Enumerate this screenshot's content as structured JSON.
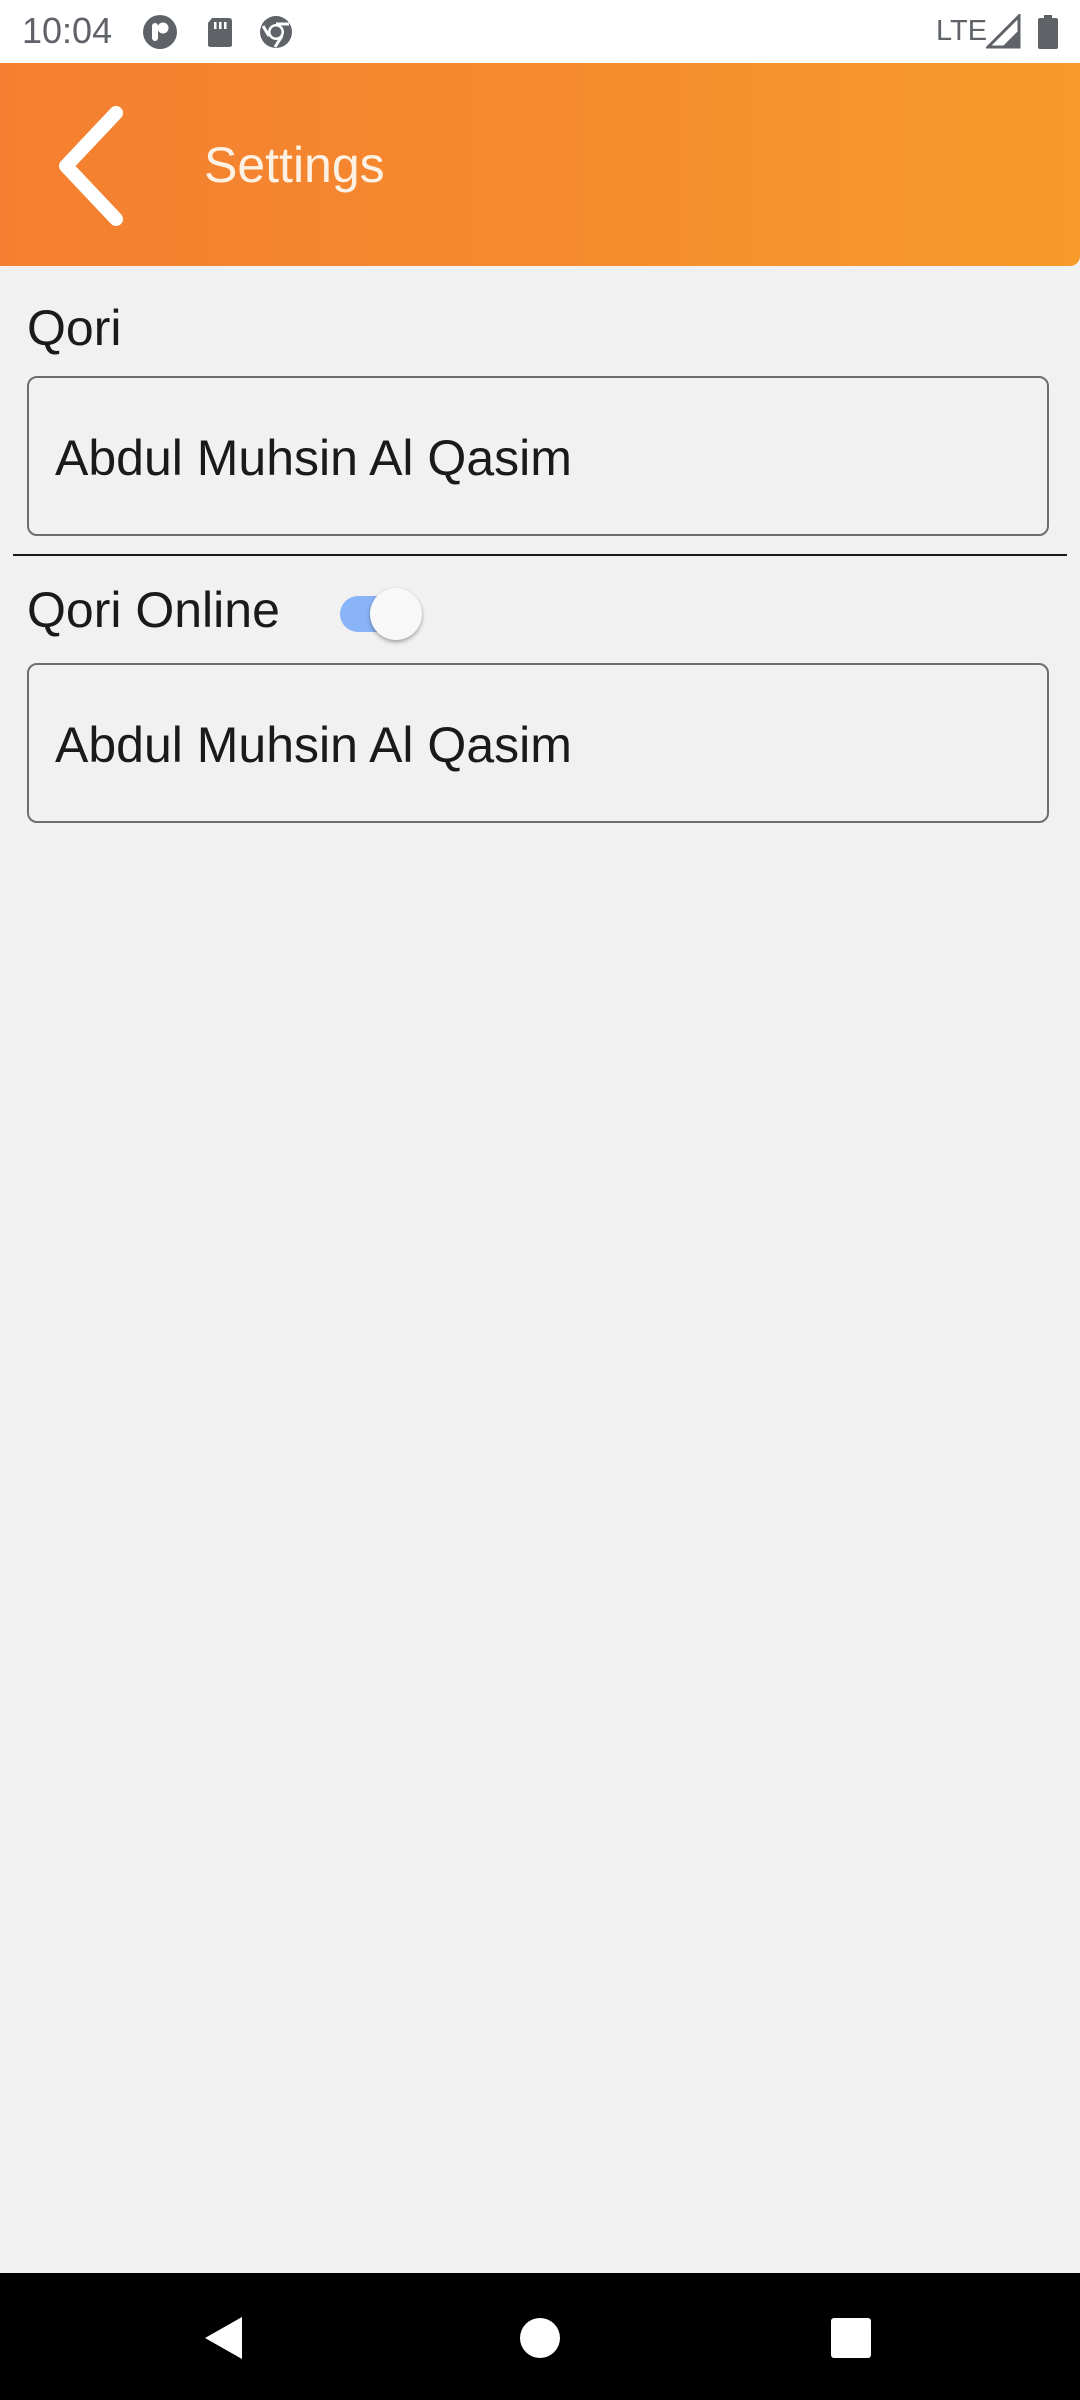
{
  "status_bar": {
    "time": "10:04",
    "network": "LTE",
    "icons": [
      "media-app-icon",
      "sd-card-icon",
      "chrome-icon",
      "signal-icon",
      "battery-icon"
    ]
  },
  "app_bar": {
    "title": "Settings",
    "background_color": "#f58a2e",
    "back_icon": "chevron-left-icon"
  },
  "settings": {
    "qori": {
      "label": "Qori",
      "value": "Abdul Muhsin Al Qasim"
    },
    "qori_online": {
      "label": "Qori Online",
      "toggle_on": true,
      "value": "Abdul Muhsin Al Qasim"
    }
  },
  "nav_bar": {
    "buttons": [
      "back-icon",
      "home-icon",
      "recents-icon"
    ]
  },
  "colors": {
    "accent": "#f58a2e",
    "toggle_track": "#8ab4f8",
    "background": "#f1f1f1"
  }
}
